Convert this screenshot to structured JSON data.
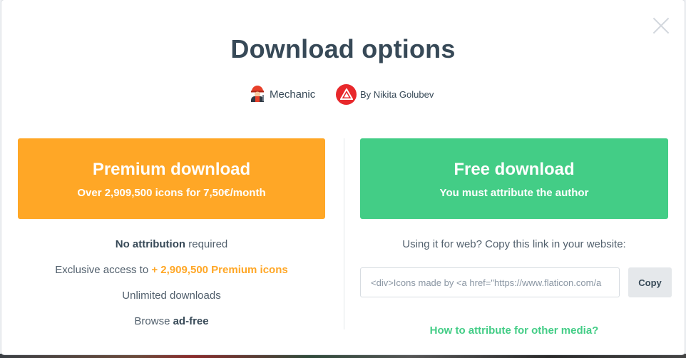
{
  "modal": {
    "title": "Download options",
    "icon": {
      "name": "mechanic-icon",
      "label": "Mechanic"
    },
    "author": {
      "label": "By Nikita Golubev",
      "logo": "author-logo-icon",
      "logo_color": "#e8282b"
    }
  },
  "premium": {
    "title": "Premium download",
    "subtitle": "Over 2,909,500 icons for 7,50€/month",
    "color": "#ffa726",
    "features": [
      {
        "strong": "No attribution",
        "rest": " required"
      },
      {
        "pre": "Exclusive access to ",
        "highlight": "+ 2,909,500 Premium icons"
      },
      {
        "text": "Unlimited downloads"
      },
      {
        "pre": "Browse ",
        "strong": "ad-free"
      }
    ]
  },
  "free": {
    "title": "Free download",
    "subtitle": "You must attribute the author",
    "color": "#43cd86",
    "web_note": "Using it for web? Copy this link in your website:",
    "attribution_code": "<div>Icons made by <a href=\"https://www.flaticon.com/a",
    "copy_label": "Copy",
    "howto_link": "How to attribute for other media?"
  },
  "icons": {
    "close": "close-icon"
  }
}
